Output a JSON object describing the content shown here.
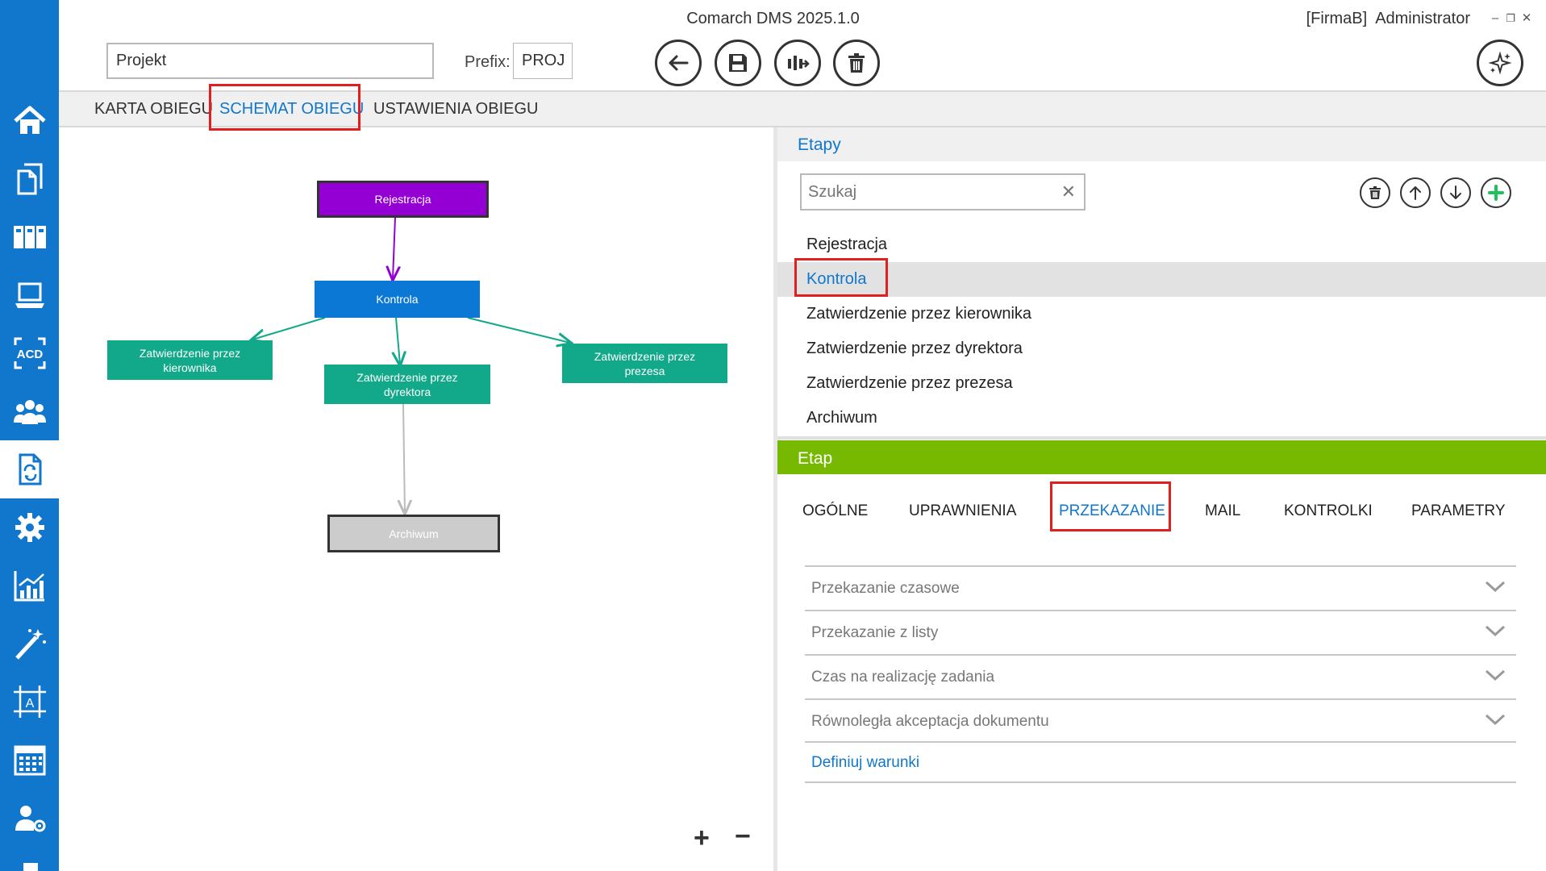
{
  "app": {
    "title": "Comarch DMS 2025.1.0",
    "company": "[FirmaB]",
    "user": "Administrator"
  },
  "window_controls": {
    "minimize": "–",
    "restore": "❐",
    "close": "✕"
  },
  "form": {
    "name_value": "Projekt",
    "prefix_label": "Prefix:",
    "prefix_value": "PROJ"
  },
  "toolbar": [
    "back-arrow-icon",
    "save-disk-icon",
    "split-flow-icon",
    "trash-icon"
  ],
  "tabs": [
    {
      "label": "KARTA OBIEGU",
      "active": false
    },
    {
      "label": "SCHEMAT OBIEGU",
      "active": true
    },
    {
      "label": "USTAWIENIA OBIEGU",
      "active": false
    }
  ],
  "sidebar": [
    {
      "icon": "home-icon"
    },
    {
      "icon": "documents-icon"
    },
    {
      "icon": "binders-icon"
    },
    {
      "icon": "laptop-icon"
    },
    {
      "icon": "ocr-acd-icon",
      "text": "ACD"
    },
    {
      "icon": "users-group-icon"
    },
    {
      "icon": "document-workflow-icon",
      "active": true
    },
    {
      "icon": "settings-gear-icon"
    },
    {
      "icon": "analytics-chart-icon"
    },
    {
      "icon": "magic-wand-icon"
    },
    {
      "icon": "designer-frame-icon",
      "text": "A"
    },
    {
      "icon": "calendar-icon"
    },
    {
      "icon": "user-settings-icon"
    }
  ],
  "diagram": {
    "nodes": [
      {
        "id": "rejestracja",
        "label": "Rejestracja",
        "color": "#9400d3"
      },
      {
        "id": "kontrola",
        "label": "Kontrola",
        "color": "#0a78d4"
      },
      {
        "id": "kierownik",
        "label": "Zatwierdzenie przez kierownika",
        "color": "#12a88a"
      },
      {
        "id": "dyrektor",
        "label": "Zatwierdzenie przez dyrektora",
        "color": "#12a88a"
      },
      {
        "id": "prezes",
        "label": "Zatwierdzenie przez prezesa",
        "color": "#12a88a"
      },
      {
        "id": "archiwum",
        "label": "Archiwum",
        "color": "#cccccc"
      }
    ],
    "edges": [
      {
        "from": "rejestracja",
        "to": "kontrola",
        "color": "#9400d3"
      },
      {
        "from": "kontrola",
        "to": "kierownik",
        "color": "#12a88a"
      },
      {
        "from": "kontrola",
        "to": "dyrektor",
        "color": "#12a88a"
      },
      {
        "from": "kontrola",
        "to": "prezes",
        "color": "#12a88a"
      },
      {
        "from": "dyrektor",
        "to": "archiwum",
        "color": "#bbbbbb"
      }
    ],
    "zoom_in": "+",
    "zoom_out": "−"
  },
  "etapy": {
    "title": "Etapy",
    "search_placeholder": "Szukaj",
    "clear_symbol": "✕",
    "actions": [
      "trash-icon",
      "arrow-up-icon",
      "arrow-down-icon",
      "add-green-icon"
    ],
    "stages": [
      {
        "label": "Rejestracja",
        "selected": false
      },
      {
        "label": "Kontrola",
        "selected": true
      },
      {
        "label": "Zatwierdzenie przez kierownika",
        "selected": false
      },
      {
        "label": "Zatwierdzenie przez dyrektora",
        "selected": false
      },
      {
        "label": "Zatwierdzenie przez prezesa",
        "selected": false
      },
      {
        "label": "Archiwum",
        "selected": false
      }
    ]
  },
  "etap": {
    "title": "Etap",
    "tabs": [
      {
        "label": "OGÓLNE",
        "active": false
      },
      {
        "label": "UPRAWNIENIA",
        "active": false
      },
      {
        "label": "PRZEKAZANIE",
        "active": true
      },
      {
        "label": "MAIL",
        "active": false
      },
      {
        "label": "KONTROLKI",
        "active": false
      },
      {
        "label": "PARAMETRY",
        "active": false
      }
    ],
    "sections": [
      "Przekazanie czasowe",
      "Przekazanie z listy",
      "Czas na realizację zadania",
      "Równoległa akceptacja dokumentu"
    ],
    "define_link": "Definiuj warunki"
  },
  "colors": {
    "sidebar": "#1177cc",
    "accent": "#1177cc",
    "etap_header": "#77b900",
    "highlight": "#e02020"
  }
}
